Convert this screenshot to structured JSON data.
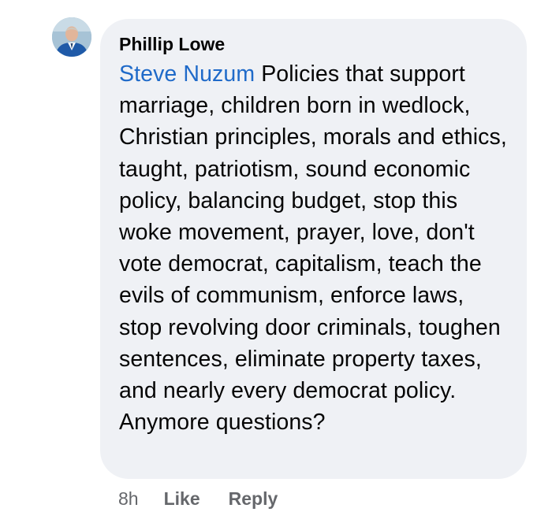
{
  "comment": {
    "author": "Phillip Lowe",
    "mention": "Steve Nuzum",
    "text": " Policies that support marriage, children born in wedlock, Christian principles, morals and ethics, taught, patriotism, sound economic policy, balancing budget, stop this woke movement, prayer, love, don't vote democrat, capitalism, teach the evils of communism, enforce laws, stop revolving door criminals, toughen sentences, eliminate property taxes, and nearly every democrat policy. Anymore questions?",
    "time": "8h",
    "like_label": "Like",
    "reply_label": "Reply"
  },
  "colors": {
    "bubble": "#eff1f5",
    "mention": "#1f6ac9",
    "meta": "#65676b"
  },
  "icons": {
    "avatar": "profile-photo"
  }
}
